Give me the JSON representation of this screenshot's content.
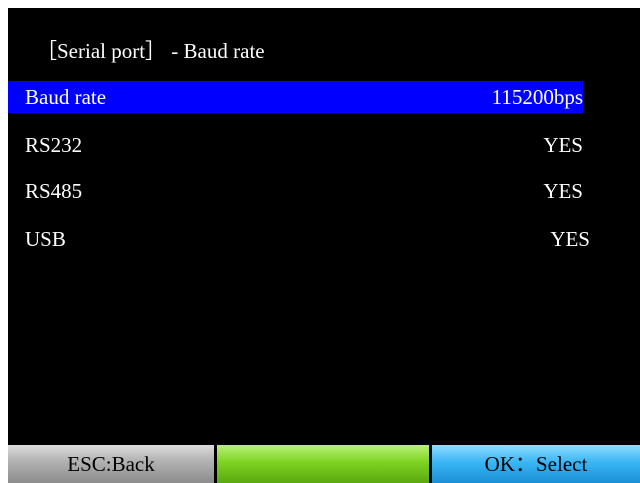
{
  "screen": {
    "title": "［Serial port］ - Baud rate"
  },
  "menu": {
    "items": [
      {
        "label": "Baud rate",
        "value": "115200bps",
        "selected": true
      },
      {
        "label": "RS232",
        "value": "YES",
        "selected": false
      },
      {
        "label": "RS485",
        "value": "YES",
        "selected": false
      },
      {
        "label": "USB",
        "value": "YES",
        "selected": false
      }
    ]
  },
  "softkeys": {
    "back_label": "ESC:Back",
    "middle_label": "",
    "ok_label": "OK：Select"
  },
  "colors": {
    "background": "#000000",
    "selection": "#0000ff",
    "back_key": "#b4b4b4",
    "middle_key": "#7ed321",
    "ok_key": "#3ab6f5"
  }
}
